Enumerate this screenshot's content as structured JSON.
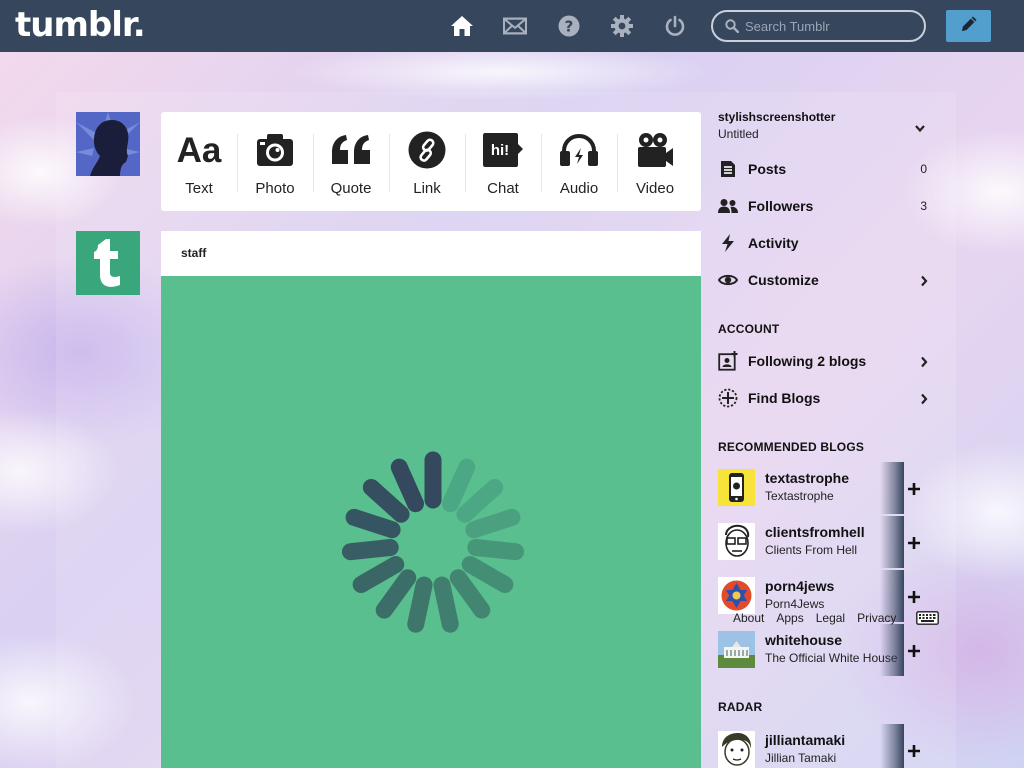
{
  "header": {
    "logo": "tumblr.",
    "search_placeholder": "Search Tumblr",
    "icons": [
      "home-icon",
      "mail-icon",
      "help-icon",
      "gear-icon",
      "power-icon"
    ],
    "compose_icon": "pencil-icon",
    "compose_color": "#529ecc",
    "bar_color": "#36465d"
  },
  "post_types": [
    {
      "label": "Text",
      "icon": "text-icon"
    },
    {
      "label": "Photo",
      "icon": "camera-icon"
    },
    {
      "label": "Quote",
      "icon": "quote-icon"
    },
    {
      "label": "Link",
      "icon": "link-icon"
    },
    {
      "label": "Chat",
      "icon": "chat-icon"
    },
    {
      "label": "Audio",
      "icon": "headphones-icon"
    },
    {
      "label": "Video",
      "icon": "video-camera-icon"
    }
  ],
  "post": {
    "author": "staff",
    "image_color": "#5abf8e"
  },
  "sidebar": {
    "blog_name": "stylishscreenshotter",
    "blog_title": "Untitled",
    "rows": [
      {
        "label": "Posts",
        "count": "0",
        "icon": "posts-icon"
      },
      {
        "label": "Followers",
        "count": "3",
        "icon": "followers-icon"
      },
      {
        "label": "Activity",
        "icon": "lightning-icon"
      },
      {
        "label": "Customize",
        "icon": "eye-icon"
      }
    ],
    "account_heading": "ACCOUNT",
    "account_rows": [
      {
        "label": "Following 2 blogs",
        "icon": "following-icon"
      },
      {
        "label": "Find Blogs",
        "icon": "compass-icon"
      }
    ],
    "recommended_heading": "RECOMMENDED BLOGS",
    "recommended": [
      {
        "name": "textastrophe",
        "title": "Textastrophe"
      },
      {
        "name": "clientsfromhell",
        "title": "Clients From Hell"
      },
      {
        "name": "porn4jews",
        "title": "Porn4Jews"
      },
      {
        "name": "whitehouse",
        "title": "The Official White House"
      }
    ],
    "footer_links": [
      "About",
      "Apps",
      "Legal",
      "Privacy"
    ],
    "radar_heading": "RADAR",
    "radar": [
      {
        "name": "jilliantamaki",
        "title": "Jillian Tamaki"
      }
    ]
  }
}
